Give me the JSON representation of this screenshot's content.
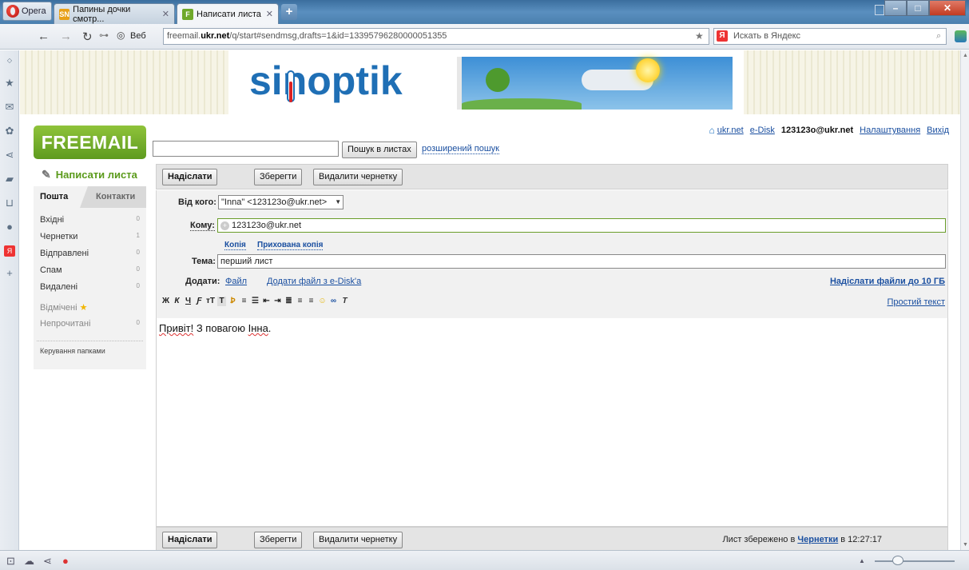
{
  "browser": {
    "opera_label": "Opera",
    "tabs": [
      {
        "title": "Папины дочки смотр...",
        "favicon": "SN",
        "active": false
      },
      {
        "title": "Написати листа",
        "favicon": "F",
        "active": true
      }
    ],
    "web_label": "Веб",
    "url_prefix": "freemail.",
    "url_domain": "ukr.net",
    "url_path": "/q/start#sendmsg,drafts=1&id=13395796280000051355",
    "search_placeholder": "Искать в Яндекс",
    "yandex_icon": "Я"
  },
  "site": {
    "banner_logo": "sinoptik",
    "logo": "FREEMAIL"
  },
  "header": {
    "home_link": "ukr.net",
    "edisk_link": "e-Disk",
    "user": "123123o@ukr.net",
    "settings_link": "Налаштування",
    "logout_link": "Вихід",
    "search_button": "Пошук в листах",
    "advanced_search": "розширений пошук"
  },
  "sidebar": {
    "compose": "Написати листа",
    "tab_mail": "Пошта",
    "tab_contacts": "Контакти",
    "folders": [
      {
        "label": "Вхідні",
        "count": "0"
      },
      {
        "label": "Чернетки",
        "count": "1"
      },
      {
        "label": "Відправлені",
        "count": "0"
      },
      {
        "label": "Спам",
        "count": "0"
      },
      {
        "label": "Видалені",
        "count": "0"
      }
    ],
    "marked": "Відмічені",
    "unread": "Непрочитані",
    "unread_count": "0",
    "manage": "Керування папками"
  },
  "toolbar": {
    "send": "Надіслати",
    "save": "Зберегти",
    "delete_draft": "Видалити чернетку"
  },
  "form": {
    "from_label": "Від кого:",
    "from_value": "\"Inna\" <123123o@ukr.net>",
    "to_label": "Кому:",
    "to_value": "123123o@ukr.net",
    "cc": "Копія",
    "bcc": "Прихована копія",
    "subject_label": "Тема:",
    "subject_value": "перший лист",
    "attach_label": "Додати:",
    "attach_file": "Файл",
    "attach_edisk": "Додати файл з e-Disk'a",
    "upload_big": "Надіслати файли до 10 ГБ",
    "plain_text": "Простий текст",
    "format_buttons": [
      "Ж",
      "К",
      "Ч",
      "Ƒ",
      "тT",
      "T",
      "Ꝧ",
      "≡",
      "☰",
      "⇤",
      "⇥",
      "≣",
      "≡",
      "≡",
      "☺",
      "∞",
      "T"
    ]
  },
  "body": {
    "greeting": "Привіт!",
    "rest": " З повагою ",
    "name": "Інна",
    "end": "."
  },
  "footer": {
    "status_prefix": "Лист збережено в ",
    "status_folder": "Чернетки",
    "status_suffix": " в 12:27:17"
  },
  "colors": {
    "brand_green": "#6fa82a",
    "link_blue": "#1a4fa0",
    "sinoptik_blue": "#1f6fb5"
  }
}
